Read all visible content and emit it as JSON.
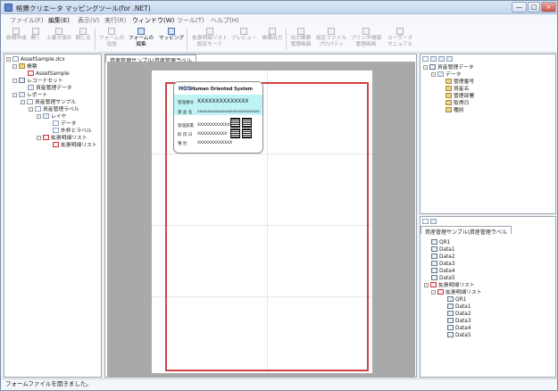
{
  "window": {
    "title": "帳票クリエータ マッピングツール(for .NET)",
    "min_symbol": "—",
    "max_symbol": "□",
    "close_symbol": "×"
  },
  "menu": [
    {
      "label": "ファイル(F)",
      "active": false
    },
    {
      "label": "編集(E)",
      "active": true
    },
    {
      "label": "表示(V)",
      "active": false
    },
    {
      "label": "実行(R)",
      "active": false
    },
    {
      "label": "ウィンドウ(W)",
      "active": true
    },
    {
      "label": "ツール(T)",
      "active": false
    },
    {
      "label": "ヘルプ(H)",
      "active": false
    }
  ],
  "toolbar": [
    {
      "label": "新規作成",
      "active": false
    },
    {
      "label": "開く",
      "active": false
    },
    {
      "label": "上書き保存",
      "active": false
    },
    {
      "label": "閉じる",
      "active": false
    },
    {
      "label": "フォームの\n追加",
      "active": false
    },
    {
      "label": "フォームの\n編集",
      "active": true
    },
    {
      "label": "マッピング",
      "active": true
    },
    {
      "label": "拡張明細リスト\n設定モード",
      "active": false
    },
    {
      "label": "プレビュー",
      "active": false
    },
    {
      "label": "帳票出力",
      "active": false
    },
    {
      "label": "出力帳票\n管理画面",
      "active": false
    },
    {
      "label": "設定ファイル\nプロパティ",
      "active": false
    },
    {
      "label": "プリンタ情報\n管理画面",
      "active": false
    },
    {
      "label": "ユーザーズ\nマニュアル",
      "active": false
    }
  ],
  "left_tree": [
    {
      "label": "AssetSample.dcx"
    },
    {
      "label": "帳票"
    },
    {
      "label": "AssetSample"
    },
    {
      "label": "レコードセット"
    },
    {
      "label": "資産管理データ"
    },
    {
      "label": "レポート"
    },
    {
      "label": "資産管理サンプル"
    },
    {
      "label": "資産管理ラベル"
    },
    {
      "label": "レイヤ"
    },
    {
      "label": "データ"
    },
    {
      "label": "外枠とラベル"
    },
    {
      "label": "拡張明細リスト"
    },
    {
      "label": "拡張明細リスト"
    }
  ],
  "center": {
    "tab_label": "資産管理サンプル\\資産管理ラベル",
    "label_logo": "HOS",
    "label_company": "Human Oriented System",
    "label_rows": [
      {
        "label": "管理番号",
        "value": "XXXXXXXXXXXXXX"
      },
      {
        "label": "資 産 名",
        "value": "XXXXXXXXXXXXXXXXXXXXXXXXXXXXXX"
      },
      {
        "label": "管理部署",
        "value": "XXXXXXXXXXXXX"
      },
      {
        "label": "取 得 日",
        "value": "XXXXXXXXXXX"
      },
      {
        "label": "種   別",
        "value": "XXXXXXXXXXXXX"
      }
    ]
  },
  "right_top_tree": [
    {
      "label": "資産管理データ"
    },
    {
      "label": "データ"
    },
    {
      "label": "管理番号"
    },
    {
      "label": "資産名"
    },
    {
      "label": "管理部署"
    },
    {
      "label": "取得日"
    },
    {
      "label": "種別"
    }
  ],
  "right_bottom": {
    "tab_label": "資産管理サンプル\\資産管理ラベル",
    "tree": [
      {
        "label": "QR1"
      },
      {
        "label": "Data1"
      },
      {
        "label": "Data2"
      },
      {
        "label": "Data3"
      },
      {
        "label": "Data4"
      },
      {
        "label": "Data5"
      },
      {
        "label": "拡張明細リスト"
      },
      {
        "label": "拡張明細リスト"
      },
      {
        "label": "QR1"
      },
      {
        "label": "Data1"
      },
      {
        "label": "Data2"
      },
      {
        "label": "Data3"
      },
      {
        "label": "Data4"
      },
      {
        "label": "Data5"
      }
    ]
  },
  "status": {
    "text": "フォームファイルを開きました。"
  }
}
